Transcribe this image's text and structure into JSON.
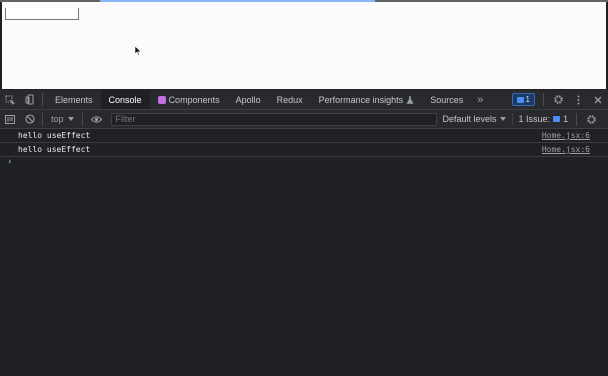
{
  "viewport": {
    "input_value": ""
  },
  "devtools": {
    "tabs": [
      {
        "label": "Elements"
      },
      {
        "label": "Console"
      },
      {
        "label": "Components"
      },
      {
        "label": "Apollo"
      },
      {
        "label": "Redux"
      },
      {
        "label": "Performance insights"
      },
      {
        "label": "Sources"
      }
    ],
    "more_tabs": "»",
    "messages_badge_count": "1"
  },
  "console_toolbar": {
    "context": "top",
    "filter_placeholder": "Filter",
    "levels_label": "Default levels",
    "issues_label": "1 Issue:",
    "issues_count": "1"
  },
  "console": {
    "messages": [
      {
        "text": "hello useEffect",
        "source": "Home.jsx:6"
      },
      {
        "text": "hello useEffect",
        "source": "Home.jsx:6"
      }
    ],
    "prompt": "›"
  },
  "colors": {
    "active_tab_bg": "#202124",
    "accent_blue": "#8ab4f8",
    "components_icon": "#c26de3"
  }
}
